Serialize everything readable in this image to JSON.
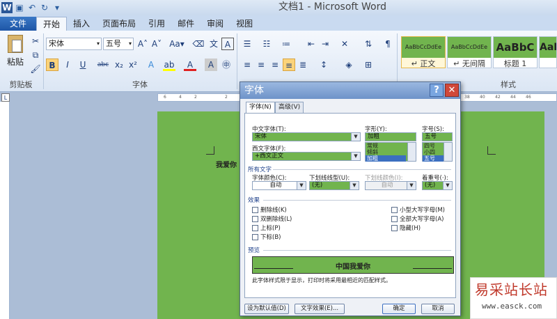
{
  "window_title": "文档1 - Microsoft Word",
  "ribbon_tabs": [
    "文件",
    "开始",
    "插入",
    "页面布局",
    "引用",
    "邮件",
    "审阅",
    "视图"
  ],
  "clipboard": {
    "paste_label": "粘贴",
    "group_label": "剪贴板"
  },
  "font_group": {
    "font_name": "宋体",
    "font_size": "五号",
    "group_label": "字体"
  },
  "styles": {
    "group_label": "样式",
    "items": [
      {
        "sample": "AaBbCcDdEe",
        "name": "↵ 正文"
      },
      {
        "sample": "AaBbCcDdEe",
        "name": "↵ 无间隔"
      },
      {
        "sample": "AaBbC",
        "name": "标题 1"
      },
      {
        "sample": "AaBl",
        "name": ""
      }
    ]
  },
  "ruler_ticks": [
    "6",
    "4",
    "2",
    "2",
    "4",
    "6",
    "38",
    "40",
    "42",
    "44",
    "46"
  ],
  "document_text": "我爱你",
  "dialog": {
    "title": "字体",
    "help": "?",
    "close": "✕",
    "tabs": [
      "字体(N)",
      "高级(V)"
    ],
    "chinese_font_label": "中文字体(T):",
    "chinese_font_value": "宋体",
    "western_font_label": "西文字体(F):",
    "western_font_value": "+西文正文",
    "style_label": "字形(Y):",
    "style_value": "加粗",
    "style_options": [
      "常规",
      "倾斜",
      "加粗"
    ],
    "size_label": "字号(S):",
    "size_value": "五号",
    "size_options": [
      "四号",
      "小四",
      "五号"
    ],
    "all_text_section": "所有文字",
    "font_color_label": "字体颜色(C):",
    "font_color_value": "自动",
    "underline_type_label": "下划线线型(U):",
    "underline_type_value": "(无)",
    "underline_color_label": "下划线颜色(I):",
    "underline_color_value": "自动",
    "emphasis_label": "着重号(·):",
    "emphasis_value": "(无)",
    "effects_section": "效果",
    "effects_left": [
      "删除线(K)",
      "双删除线(L)",
      "上标(P)",
      "下标(B)"
    ],
    "effects_right": [
      "小型大写字母(M)",
      "全部大写字母(A)",
      "隐藏(H)"
    ],
    "preview_section": "预览",
    "preview_text": "中国我爱你",
    "preview_note": "此字体样式限于显示，打印时将采用最相近的匹配样式。",
    "set_default_button": "设为默认值(D)",
    "text_effects_button": "文字效果(E)...",
    "ok_button": "确定",
    "cancel_button": "取消"
  },
  "watermark": {
    "name": "易采站长站",
    "url": "www.easck.com"
  },
  "colors": {
    "accent": "#2b5797",
    "page_green": "#71b44e",
    "selection_blue": "#3b6fc0"
  }
}
